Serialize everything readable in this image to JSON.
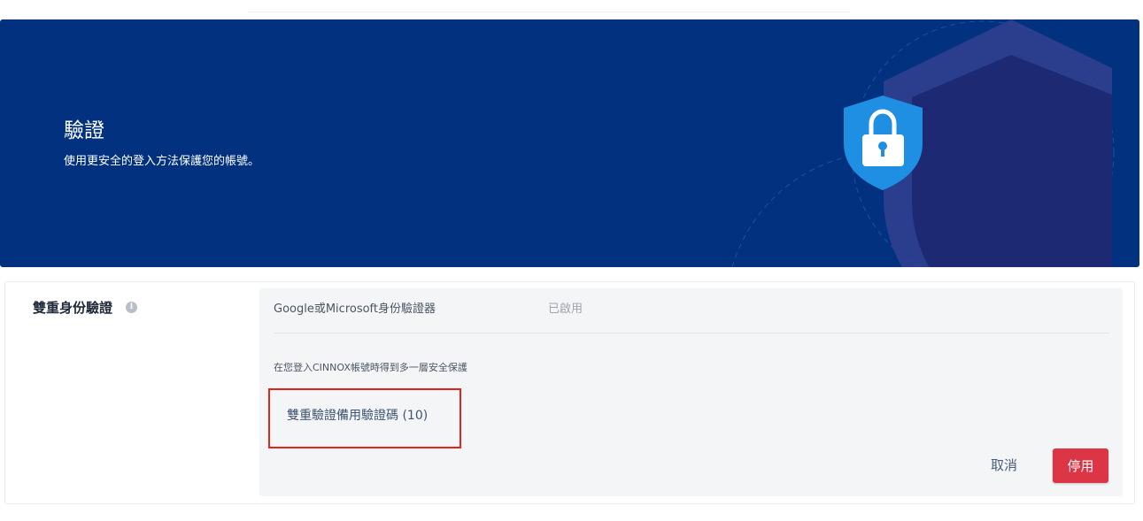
{
  "banner": {
    "title": "驗證",
    "subtitle": "使用更安全的登入方法保護您的帳號。",
    "background_color": "#02317f",
    "icon": "shield-lock-icon"
  },
  "two_factor": {
    "section_label": "雙重身份驗證",
    "info_icon": "info-icon",
    "method_name": "Google或Microsoft身份驗證器",
    "method_status": "已啟用",
    "description": "在您登入CINNOX帳號時得到多一層安全保護",
    "backup_codes_link": "雙重驗證備用驗證碼 (10)",
    "cancel_label": "取消",
    "disable_label": "停用",
    "disable_color": "#dc3545",
    "highlight_color": "#e4231b"
  }
}
